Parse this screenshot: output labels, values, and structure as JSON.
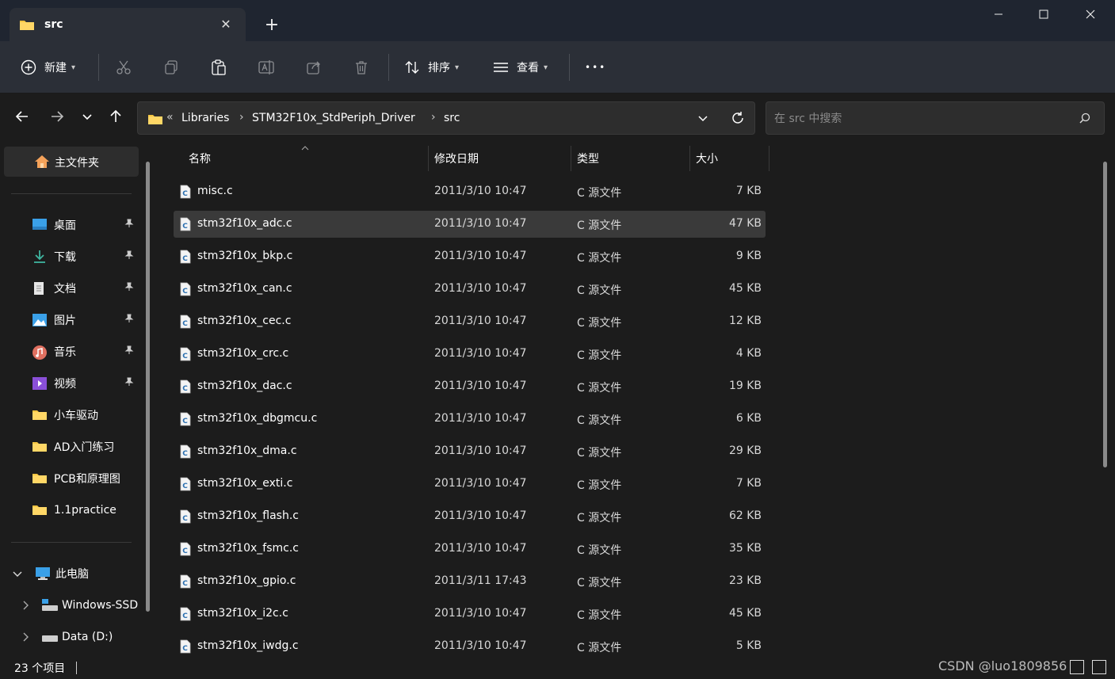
{
  "window": {
    "tab_title": "src",
    "tab_close": "✕",
    "new_tab": "+",
    "minimize": "—",
    "maximize": "☐",
    "close": "✕"
  },
  "toolbar": {
    "new_label": "新建",
    "sort_label": "排序",
    "view_label": "查看",
    "more_label": "•••"
  },
  "address": {
    "overflow": "«",
    "crumbs": [
      "Libraries",
      "STM32F10x_StdPeriph_Driver",
      "src"
    ],
    "separator": "›",
    "search_placeholder": "在 src 中搜索"
  },
  "sidebar": {
    "home": "主文件夹",
    "quick": [
      {
        "label": "桌面",
        "icon": "desktop-icon",
        "pinned": true
      },
      {
        "label": "下载",
        "icon": "download-icon",
        "pinned": true
      },
      {
        "label": "文档",
        "icon": "document-icon",
        "pinned": true
      },
      {
        "label": "图片",
        "icon": "pictures-icon",
        "pinned": true
      },
      {
        "label": "音乐",
        "icon": "music-icon",
        "pinned": true
      },
      {
        "label": "视频",
        "icon": "video-icon",
        "pinned": true
      },
      {
        "label": "小车驱动",
        "icon": "folder-icon",
        "pinned": false
      },
      {
        "label": "AD入门练习",
        "icon": "folder-icon",
        "pinned": false
      },
      {
        "label": "PCB和原理图",
        "icon": "folder-icon",
        "pinned": false
      },
      {
        "label": "1.1practice",
        "icon": "folder-icon",
        "pinned": false
      }
    ],
    "this_pc": "此电脑",
    "drives": [
      "Windows-SSD",
      "Data (D:)"
    ]
  },
  "columns": {
    "name": "名称",
    "date": "修改日期",
    "type": "类型",
    "size": "大小"
  },
  "files": [
    {
      "name": "misc.c",
      "date": "2011/3/10 10:47",
      "type": "C 源文件",
      "size": "7 KB"
    },
    {
      "name": "stm32f10x_adc.c",
      "date": "2011/3/10 10:47",
      "type": "C 源文件",
      "size": "47 KB",
      "selected": true
    },
    {
      "name": "stm32f10x_bkp.c",
      "date": "2011/3/10 10:47",
      "type": "C 源文件",
      "size": "9 KB"
    },
    {
      "name": "stm32f10x_can.c",
      "date": "2011/3/10 10:47",
      "type": "C 源文件",
      "size": "45 KB"
    },
    {
      "name": "stm32f10x_cec.c",
      "date": "2011/3/10 10:47",
      "type": "C 源文件",
      "size": "12 KB"
    },
    {
      "name": "stm32f10x_crc.c",
      "date": "2011/3/10 10:47",
      "type": "C 源文件",
      "size": "4 KB"
    },
    {
      "name": "stm32f10x_dac.c",
      "date": "2011/3/10 10:47",
      "type": "C 源文件",
      "size": "19 KB"
    },
    {
      "name": "stm32f10x_dbgmcu.c",
      "date": "2011/3/10 10:47",
      "type": "C 源文件",
      "size": "6 KB"
    },
    {
      "name": "stm32f10x_dma.c",
      "date": "2011/3/10 10:47",
      "type": "C 源文件",
      "size": "29 KB"
    },
    {
      "name": "stm32f10x_exti.c",
      "date": "2011/3/10 10:47",
      "type": "C 源文件",
      "size": "7 KB"
    },
    {
      "name": "stm32f10x_flash.c",
      "date": "2011/3/10 10:47",
      "type": "C 源文件",
      "size": "62 KB"
    },
    {
      "name": "stm32f10x_fsmc.c",
      "date": "2011/3/10 10:47",
      "type": "C 源文件",
      "size": "35 KB"
    },
    {
      "name": "stm32f10x_gpio.c",
      "date": "2011/3/11 17:43",
      "type": "C 源文件",
      "size": "23 KB"
    },
    {
      "name": "stm32f10x_i2c.c",
      "date": "2011/3/10 10:47",
      "type": "C 源文件",
      "size": "45 KB"
    },
    {
      "name": "stm32f10x_iwdg.c",
      "date": "2011/3/10 10:47",
      "type": "C 源文件",
      "size": "5 KB"
    }
  ],
  "status": {
    "item_count": "23 个项目",
    "watermark": "CSDN @luo1809856"
  },
  "colors": {
    "accent_folder": "#f4c542",
    "selected_row": "#3a3a3a",
    "titlebar": "#1f2530",
    "toolbar": "#2b2f37"
  }
}
